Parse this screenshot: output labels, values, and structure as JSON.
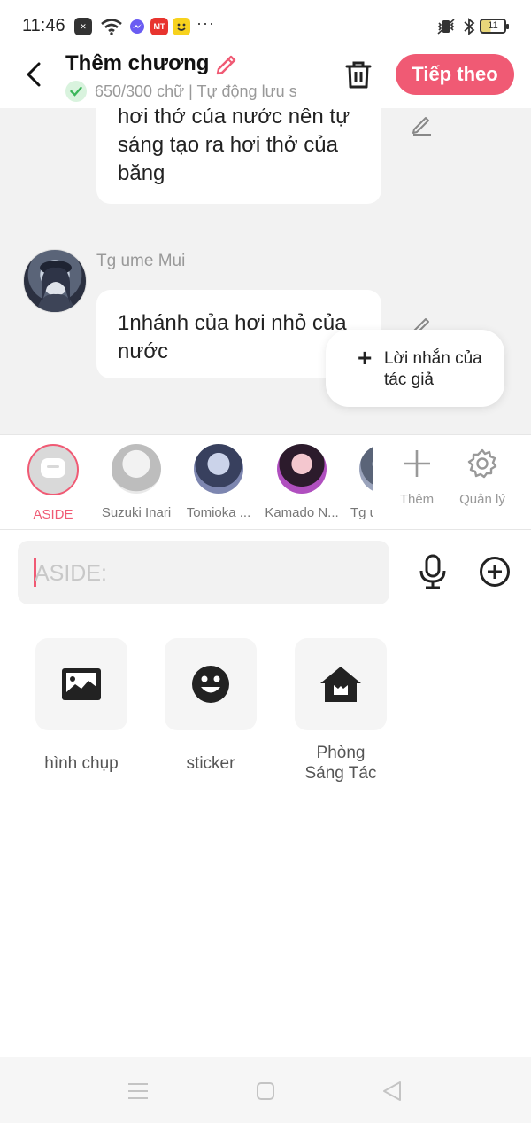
{
  "status_bar": {
    "time": "11:46",
    "battery": "11",
    "more": "···"
  },
  "header": {
    "title": "Thêm chương",
    "word_status": "650/300 chữ | Tự động lưu s",
    "next_label": "Tiếp theo",
    "accent_color": "#f05a74"
  },
  "chat": {
    "messages": [
      {
        "text": "hơi thở của nước nên tự sáng tạo ra hơi thở của băng"
      },
      {
        "sender": "Tg ume Mui",
        "text": "1nhánh của hơi nhỏ của nước"
      }
    ],
    "author_note_label": "Lời nhắn của tác giả"
  },
  "characters": {
    "items": [
      {
        "label": "ASIDE",
        "selected": true
      },
      {
        "label": "Suzuki Inari"
      },
      {
        "label": "Tomioka ..."
      },
      {
        "label": "Kamado N..."
      },
      {
        "label": "Tg u"
      }
    ],
    "add_label": "Thêm",
    "manage_label": "Quản lý"
  },
  "input": {
    "placeholder": "ASIDE:"
  },
  "attachments": [
    {
      "label": "hình chụp",
      "icon": "image-icon"
    },
    {
      "label": "sticker",
      "icon": "smiley-icon"
    },
    {
      "label": "Phòng Sáng Tác",
      "icon": "studio-house-icon"
    }
  ]
}
